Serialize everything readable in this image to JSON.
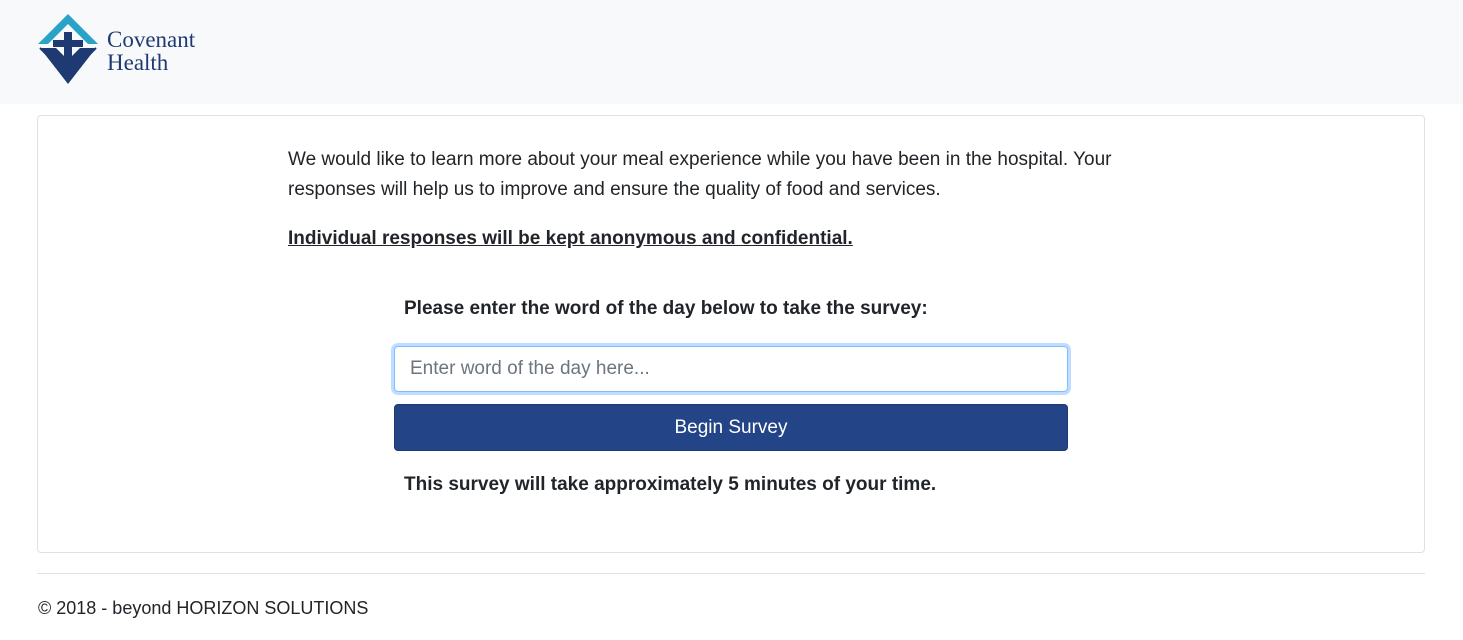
{
  "brand": {
    "logo_icon": "covenant-health-cross-icon",
    "name_line1": "Covenant",
    "name_line2": "Health",
    "colors": {
      "primary": "#1f3a73",
      "accent": "#2aa3c9"
    }
  },
  "survey": {
    "intro_text": "We would like to learn more about your meal experience while you have been in the hospital. Your responses will help us to improve and ensure the quality of food and services.",
    "anonymity_note": "Individual responses will be kept anonymous and confidential.",
    "prompt": "Please enter the word of the day below to take the survey:",
    "word_input": {
      "value": "",
      "placeholder": "Enter word of the day here..."
    },
    "begin_button_label": "Begin Survey",
    "button_color": "#234487",
    "time_note": "This survey will take approximately 5 minutes of your time."
  },
  "footer": {
    "copyright": "© 2018 - beyond HORIZON SOLUTIONS"
  }
}
